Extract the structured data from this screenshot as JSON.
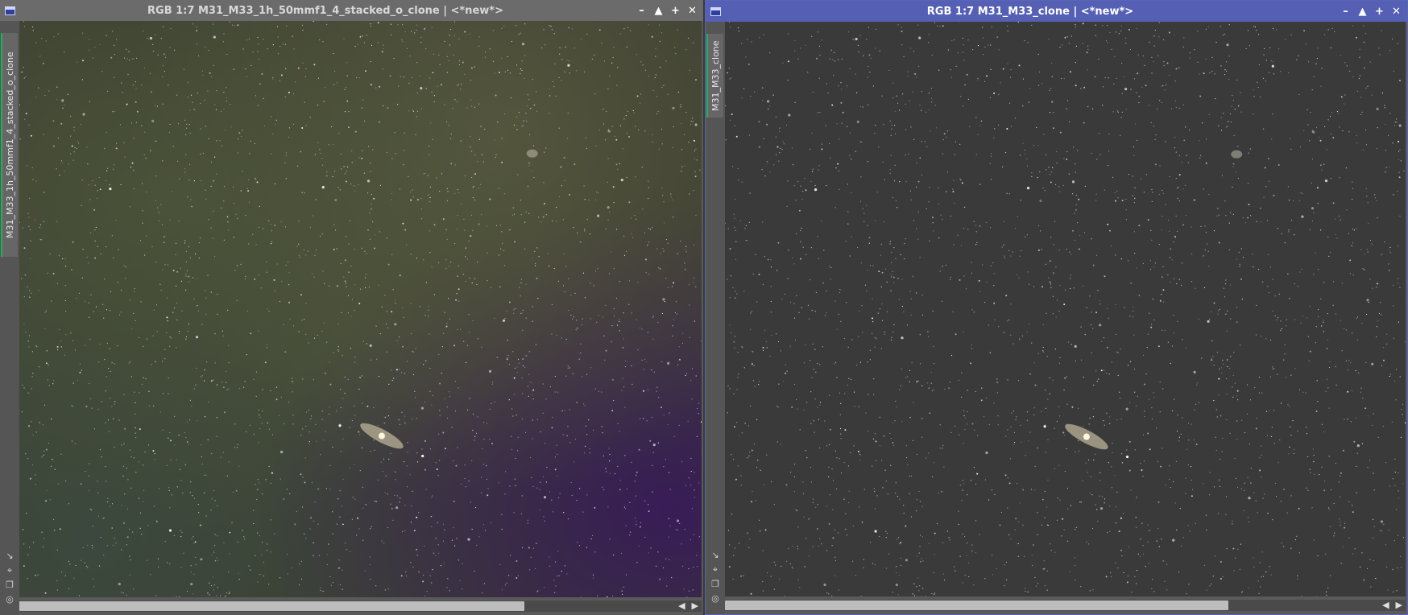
{
  "windows": [
    {
      "title": "RGB 1:7 M31_M33_1h_50mmf1_4_stacked_o_clone | <*new*>",
      "tab_label": "M31_M33_1h_50mmf1_4_stacked_o_clone",
      "active": false,
      "scroll_fraction": 0.74
    },
    {
      "title": "RGB 1:7 M31_M33_clone | <*new*>",
      "tab_label": "M31_M33_clone",
      "active": true,
      "scroll_fraction": 0.74
    }
  ],
  "title_buttons": {
    "minimize": "–",
    "shade": "▲",
    "maximize": "+",
    "close": "✕"
  },
  "side_icon_names": [
    "arrow-diagonal-icon",
    "fit-view-icon",
    "clone-window-icon",
    "target-icon"
  ],
  "scroll_arrows": {
    "left": "◀",
    "right": "▶"
  },
  "colors": {
    "active_titlebar": "#5560b5",
    "inactive_titlebar": "#6b6b6b",
    "tab_accent": "#1db35f"
  }
}
